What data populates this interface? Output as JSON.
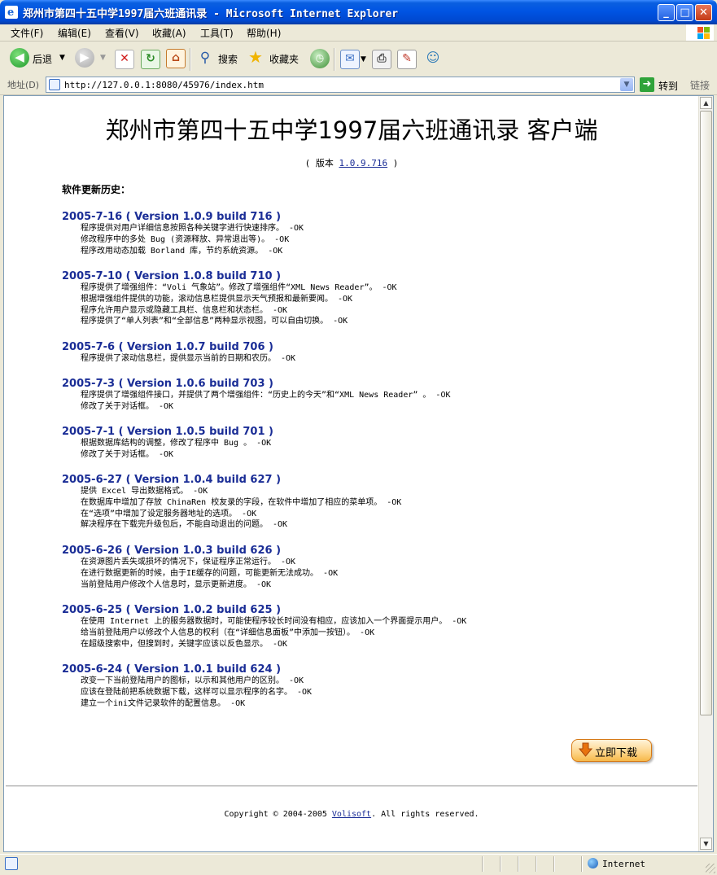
{
  "window": {
    "title": "郑州市第四十五中学1997届六班通讯录 - Microsoft Internet Explorer",
    "buttons": {
      "minimize": "_",
      "maximize": "□",
      "close": "✕"
    }
  },
  "menu": [
    {
      "label": "文件(F)"
    },
    {
      "label": "编辑(E)"
    },
    {
      "label": "查看(V)"
    },
    {
      "label": "收藏(A)"
    },
    {
      "label": "工具(T)"
    },
    {
      "label": "帮助(H)"
    }
  ],
  "toolbar": {
    "back_label": "后退",
    "search_label": "搜索",
    "favorites_label": "收藏夹"
  },
  "address": {
    "label": "地址(D)",
    "url": "http://127.0.0.1:8080/45976/index.htm",
    "go_label": "转到",
    "links_label": "链接"
  },
  "page": {
    "title": "郑州市第四十五中学1997届六班通讯录  客户端",
    "version_prefix": "( 版本 ",
    "version_link": "1.0.9.716",
    "version_suffix": " )",
    "history_heading": "软件更新历史：",
    "releases": [
      {
        "header": "2005-7-16 ( Version 1.0.9 build 716 )",
        "items": [
          "程序提供对用户详细信息按照各种关键字进行快速排序。 -OK",
          "修改程序中的多处 Bug (资源释放、异常退出等)。 -OK",
          "程序改用动态加载 Borland 库，节约系统资源。 -OK"
        ]
      },
      {
        "header": "2005-7-10 ( Version 1.0.8 build 710 )",
        "items": [
          "程序提供了增强组件：“Voli 气象站”。修改了增强组件“XML News Reader”。 -OK",
          "根据增强组件提供的功能，滚动信息栏提供显示天气预报和最新要闻。 -OK",
          "程序允许用户显示或隐藏工具栏、信息栏和状态栏。 -OK",
          "程序提供了“单人列表”和“全部信息”两种显示视图，可以自由切换。 -OK"
        ]
      },
      {
        "header": "2005-7-6 ( Version 1.0.7 build 706 )",
        "items": [
          "程序提供了滚动信息栏，提供显示当前的日期和农历。 -OK"
        ]
      },
      {
        "header": "2005-7-3 ( Version 1.0.6 build 703 )",
        "items": [
          "程序提供了增强组件接口，并提供了两个增强组件：“历史上的今天”和“XML News Reader” 。 -OK",
          "修改了关于对话框。 -OK"
        ]
      },
      {
        "header": "2005-7-1 ( Version 1.0.5 build 701 )",
        "items": [
          "根据数据库结构的调整，修改了程序中 Bug 。 -OK",
          "修改了关于对话框。 -OK"
        ]
      },
      {
        "header": "2005-6-27 ( Version 1.0.4 build 627 )",
        "items": [
          "提供 Excel 导出数据格式。 -OK",
          "在数据库中增加了存放 ChinaRen 校友录的字段，在软件中增加了相应的菜单项。 -OK",
          "在“选项”中增加了设定服务器地址的选项。 -OK",
          "解决程序在下载完升级包后，不能自动退出的问题。 -OK"
        ]
      },
      {
        "header": "2005-6-26 ( Version 1.0.3 build 626 )",
        "items": [
          "在资源图片丢失或损坏的情况下，保证程序正常运行。 -OK",
          "在进行数据更新的时候，由于IE缓存的问题，可能更新无法成功。 -OK",
          "当前登陆用户修改个人信息时，显示更新进度。 -OK"
        ]
      },
      {
        "header": "2005-6-25 ( Version 1.0.2 build 625 )",
        "items": [
          "在使用 Internet 上的服务器数据时，可能使程序较长时间没有相应，应该加入一个界面提示用户。 -OK",
          "给当前登陆用户以修改个人信息的权利（在“详细信息面板”中添加一按钮）。 -OK",
          "在超级搜索中，但搜到时，关键字应该以反色显示。 -OK"
        ]
      },
      {
        "header": "2005-6-24 ( Version 1.0.1 build 624 )",
        "items": [
          "改变一下当前登陆用户的图标，以示和其他用户的区别。 -OK",
          "应该在登陆前把系统数据下载，这样可以显示程序的名字。 -OK",
          "建立一个ini文件记录软件的配置信息。 -OK"
        ]
      }
    ],
    "download_label": "立即下载",
    "footer_prefix": "Copyright © 2004-2005 ",
    "footer_link": "Volisoft",
    "footer_suffix": ". All rights reserved."
  },
  "status": {
    "zone": "Internet"
  }
}
